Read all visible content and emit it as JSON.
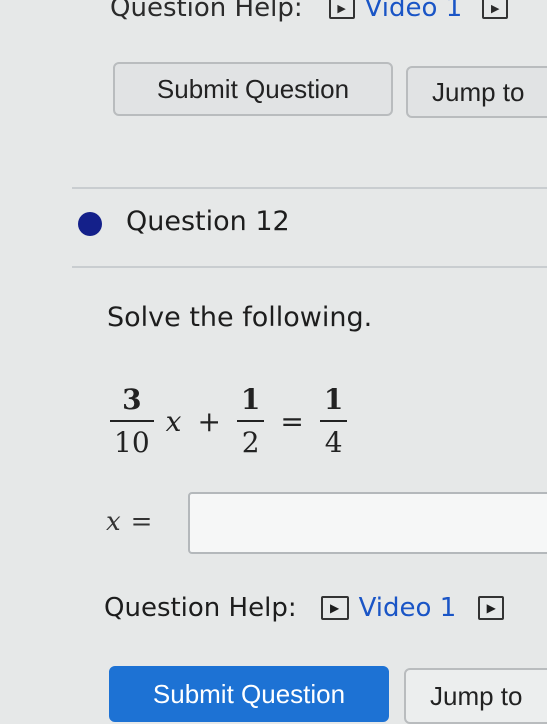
{
  "top_help": {
    "label": "Question Help:",
    "video_label": "Video 1",
    "video_icon": "play-icon"
  },
  "top_buttons": {
    "submit": "Submit Question",
    "jump": "Jump to"
  },
  "question": {
    "title": "Question 12",
    "instruction": "Solve the following.",
    "equation": {
      "frac1_num": "3",
      "frac1_den": "10",
      "variable": "x",
      "plus": "+",
      "frac2_num": "1",
      "frac2_den": "2",
      "equals": "=",
      "frac3_num": "1",
      "frac3_den": "4"
    },
    "answer": {
      "label_var": "x",
      "label_eq": "=",
      "value": ""
    }
  },
  "help": {
    "label": "Question Help:",
    "video_label": "Video 1",
    "video_icon": "play-icon"
  },
  "bottom_buttons": {
    "submit": "Submit Question",
    "jump": "Jump to"
  },
  "colors": {
    "accent": "#1d72d4",
    "question_dot": "#14208a",
    "link": "#1a55c6"
  }
}
